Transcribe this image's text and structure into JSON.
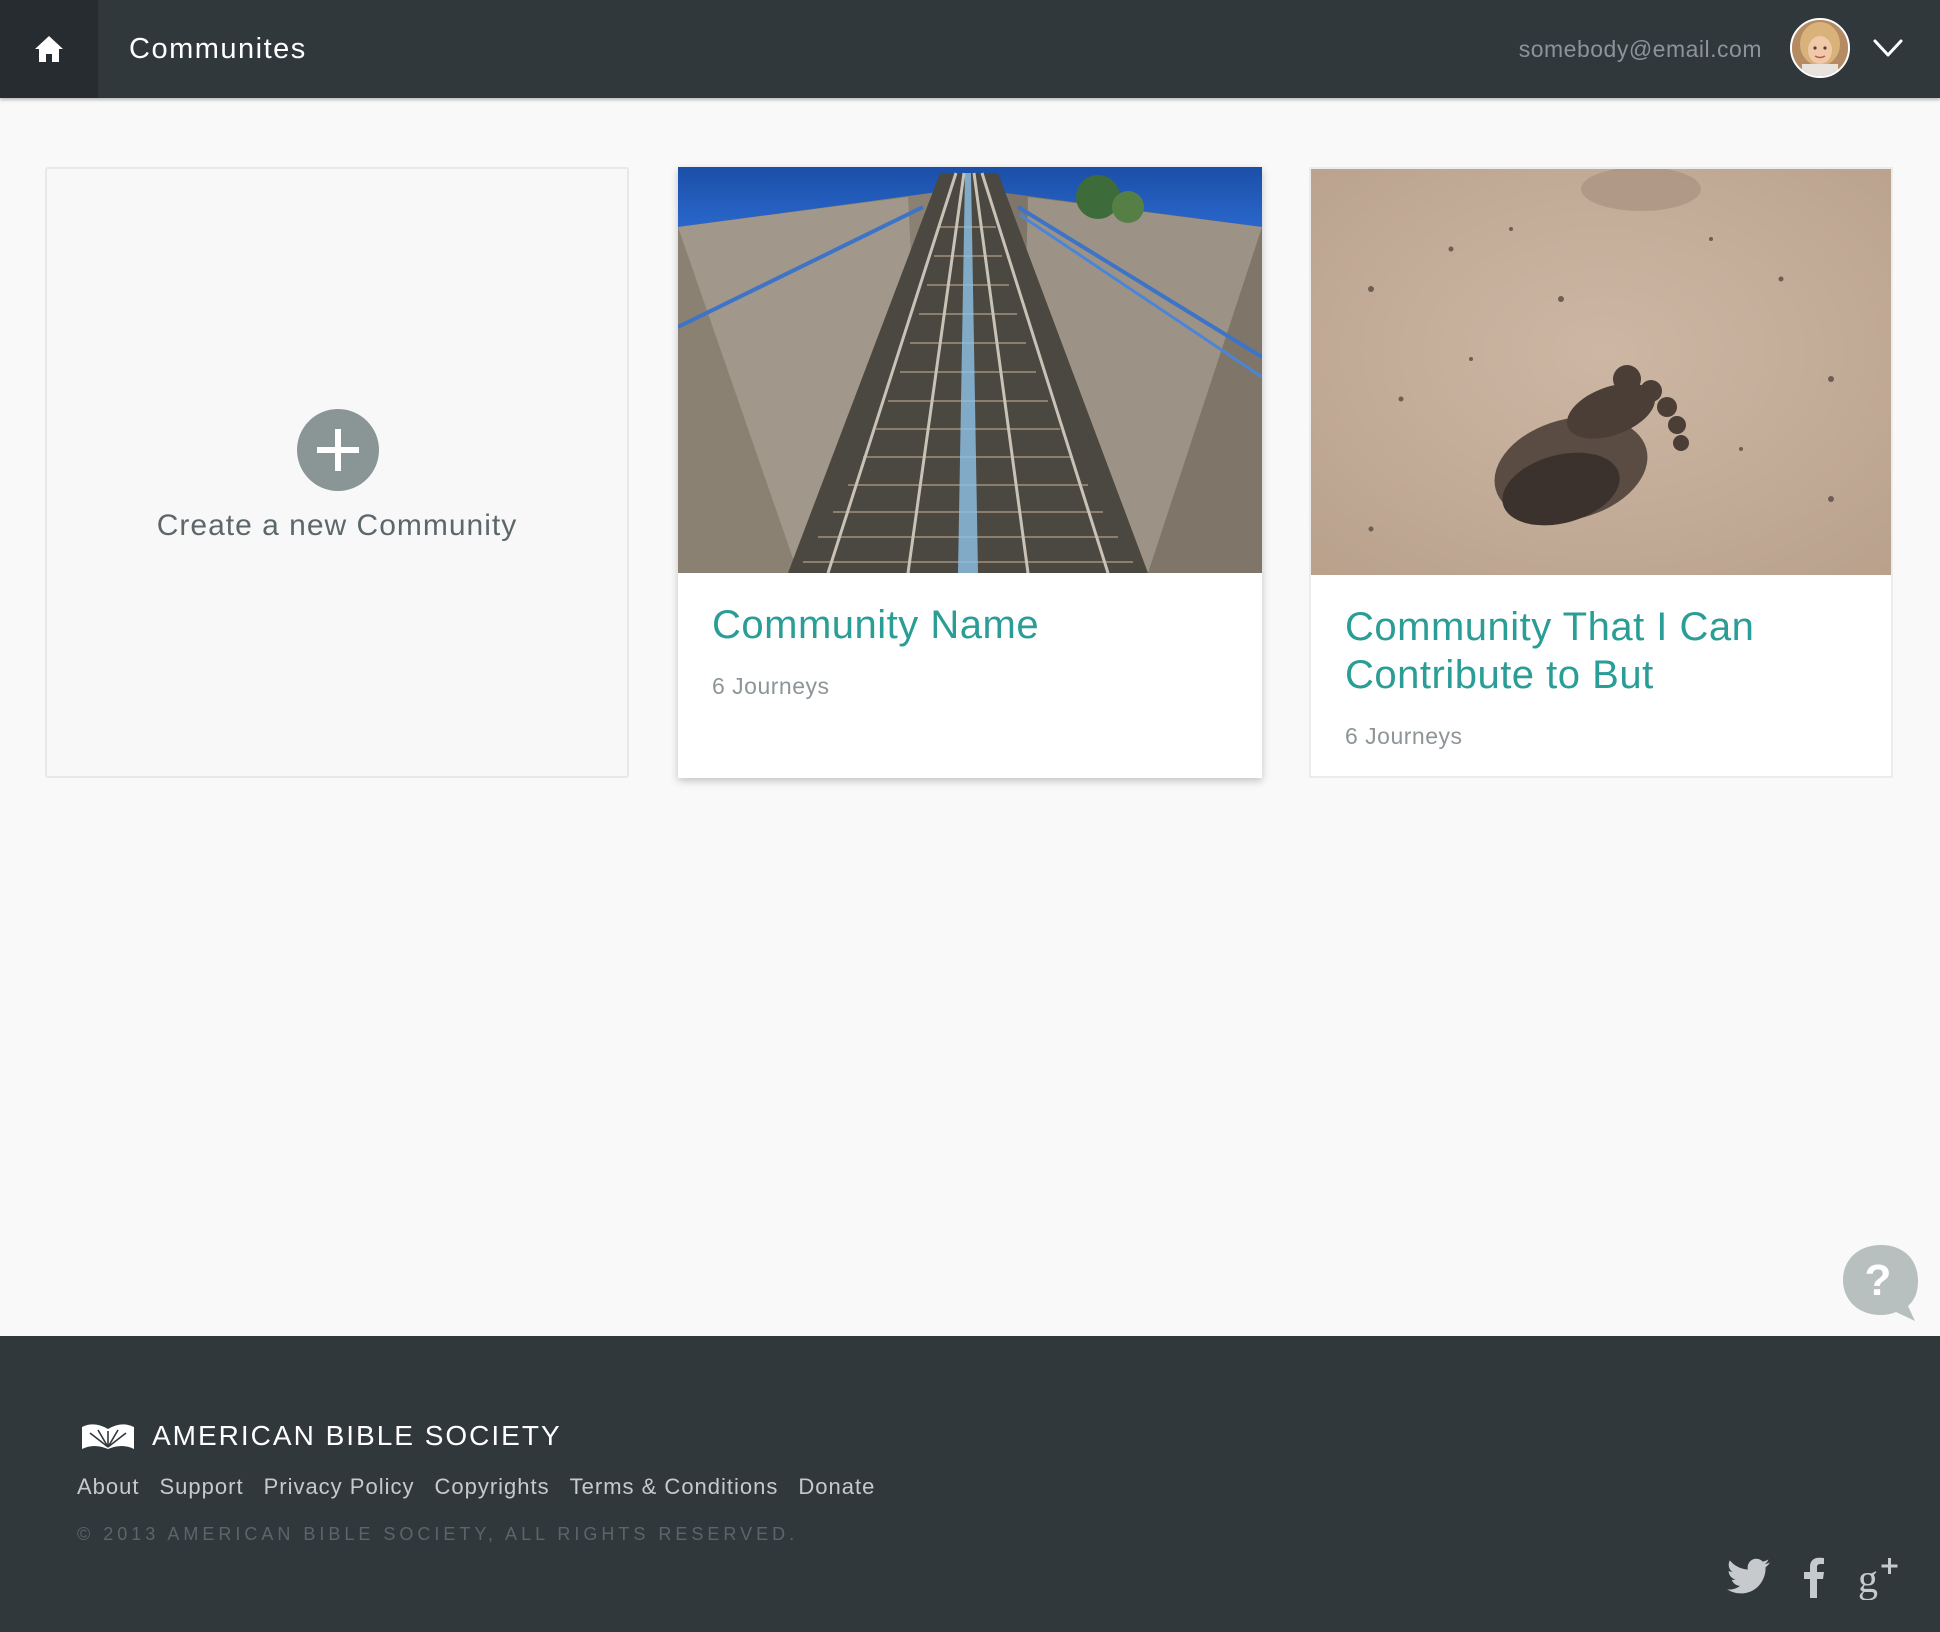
{
  "header": {
    "title": "Communites",
    "user_email": "somebody@email.com"
  },
  "create_card": {
    "label": "Create a new Community"
  },
  "communities": [
    {
      "name": "Community Name",
      "journeys": "6 Journeys"
    },
    {
      "name": "Community That I Can Contribute to But",
      "journeys": "6 Journeys"
    }
  ],
  "footer": {
    "brand": "AMERICAN BIBLE SOCIETY",
    "links": [
      "About",
      "Support",
      "Privacy Policy",
      "Copyrights",
      "Terms & Conditions",
      "Donate"
    ],
    "copyright": "© 2013 AMERICAN BIBLE SOCIETY, ALL RIGHTS RESERVED."
  },
  "icons": {
    "home": "home-icon",
    "chevron": "chevron-down-icon",
    "plus": "plus-icon",
    "help": "help-icon",
    "twitter": "twitter-icon",
    "facebook": "facebook-icon",
    "google_plus": "google-plus-icon"
  },
  "colors": {
    "header_bg": "#31383c",
    "accent": "#2a9d96",
    "page_bg": "#f9f9f9"
  }
}
